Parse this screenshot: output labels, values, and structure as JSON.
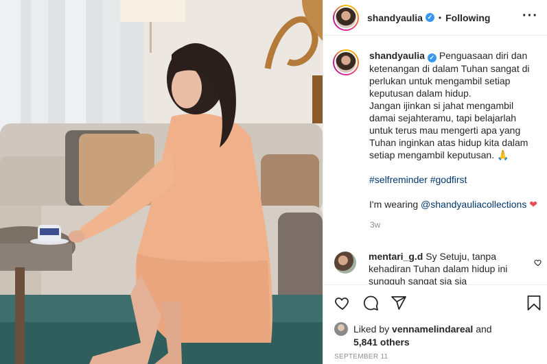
{
  "header": {
    "username": "shandyaulia",
    "separator": "•",
    "follow_status": "Following",
    "more_icon": "more-horizontal-icon"
  },
  "caption": {
    "username": "shandyaulia",
    "paragraph1": "Penguasaan diri dan ketenangan di dalam Tuhan sangat di perlukan untuk mengambil setiap keputusan dalam hidup.",
    "paragraph2": "Jangan ijinkan si jahat mengambil damai sejahteramu, tapi belajarlah untuk terus mau mengerti apa yang Tuhan inginkan atas hidup kita dalam setiap mengambil keputusan.",
    "paragraph2_emoji": "🙏",
    "hashtag1": "#selfreminder",
    "hashtag2": "#godfirst",
    "wearing_prefix": "I'm wearing",
    "wearing_mention": "@shandyauliacollections",
    "wearing_emoji": "❤",
    "time_ago": "3w"
  },
  "comment": {
    "username": "mentari_g.d",
    "text": "Sy Setuju, tanpa kehadiran Tuhan dalam hidup ini sungguh sangat sia sia"
  },
  "actions": {
    "like_icon": "heart-icon",
    "comment_icon": "comment-icon",
    "share_icon": "share-icon",
    "save_icon": "bookmark-icon"
  },
  "likes": {
    "prefix": "Liked by",
    "liker": "vennamelindareal",
    "joiner": "and",
    "others": "5,841 others"
  },
  "date": "SEPTEMBER 11",
  "colors": {
    "verified": "#3897f0",
    "link": "#00376b",
    "heart": "#ed4956",
    "muted": "#8e8e8e"
  }
}
